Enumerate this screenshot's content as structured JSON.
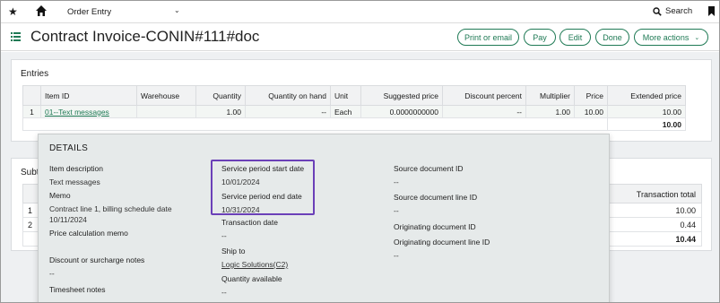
{
  "topbar": {
    "breadcrumb": "Order Entry",
    "search_label": "Search"
  },
  "title": "Contract Invoice-CONIN#111#doc",
  "actions": {
    "print_email": "Print or email",
    "pay": "Pay",
    "edit": "Edit",
    "done": "Done",
    "more_actions": "More actions"
  },
  "entries": {
    "title": "Entries",
    "columns": [
      "",
      "Item ID",
      "Warehouse",
      "Quantity",
      "Quantity on hand",
      "Unit",
      "Suggested price",
      "Discount percent",
      "Multiplier",
      "Price",
      "Extended price"
    ],
    "row": {
      "num": "1",
      "item_id": "01--Text messages",
      "warehouse": "",
      "quantity": "1.00",
      "qty_on_hand": "--",
      "unit": "Each",
      "suggested_price": "0.0000000000",
      "discount_percent": "--",
      "multiplier": "1.00",
      "price": "10.00",
      "extended_price": "10.00"
    },
    "total": "10.00"
  },
  "subtotals": {
    "title": "Subt",
    "column": "Transaction total",
    "rows": [
      {
        "num": "1",
        "value": "10.00"
      },
      {
        "num": "2",
        "value": "0.44"
      }
    ],
    "total": "10.44"
  },
  "details": {
    "title": "DETAILS",
    "item_description": {
      "label": "Item description",
      "value": "Text messages"
    },
    "memo": {
      "label": "Memo",
      "value_line1": "Contract line 1, billing schedule date",
      "value_line2": "10/11/2024"
    },
    "price_calc_memo": {
      "label": "Price calculation memo"
    },
    "discount_notes": {
      "label": "Discount or surcharge notes",
      "value": "--"
    },
    "timesheet_notes": {
      "label": "Timesheet notes"
    },
    "service_start": {
      "label": "Service period start date",
      "value": "10/01/2024"
    },
    "service_end": {
      "label": "Service period end date",
      "value": "10/31/2024"
    },
    "transaction_date": {
      "label": "Transaction date",
      "value": "--"
    },
    "ship_to": {
      "label": "Ship to",
      "value": "Logic Solutions(C2)"
    },
    "quantity_available": {
      "label": "Quantity available",
      "value": "--"
    },
    "source_doc_id": {
      "label": "Source document ID",
      "value": "--"
    },
    "source_doc_line_id": {
      "label": "Source document line ID",
      "value": "--"
    },
    "originating_doc_id": {
      "label": "Originating document ID"
    },
    "originating_doc_line_id": {
      "label": "Originating document line ID",
      "value": "--"
    }
  },
  "colors": {
    "accent": "#1f7a55",
    "highlight": "#6b40b8"
  }
}
